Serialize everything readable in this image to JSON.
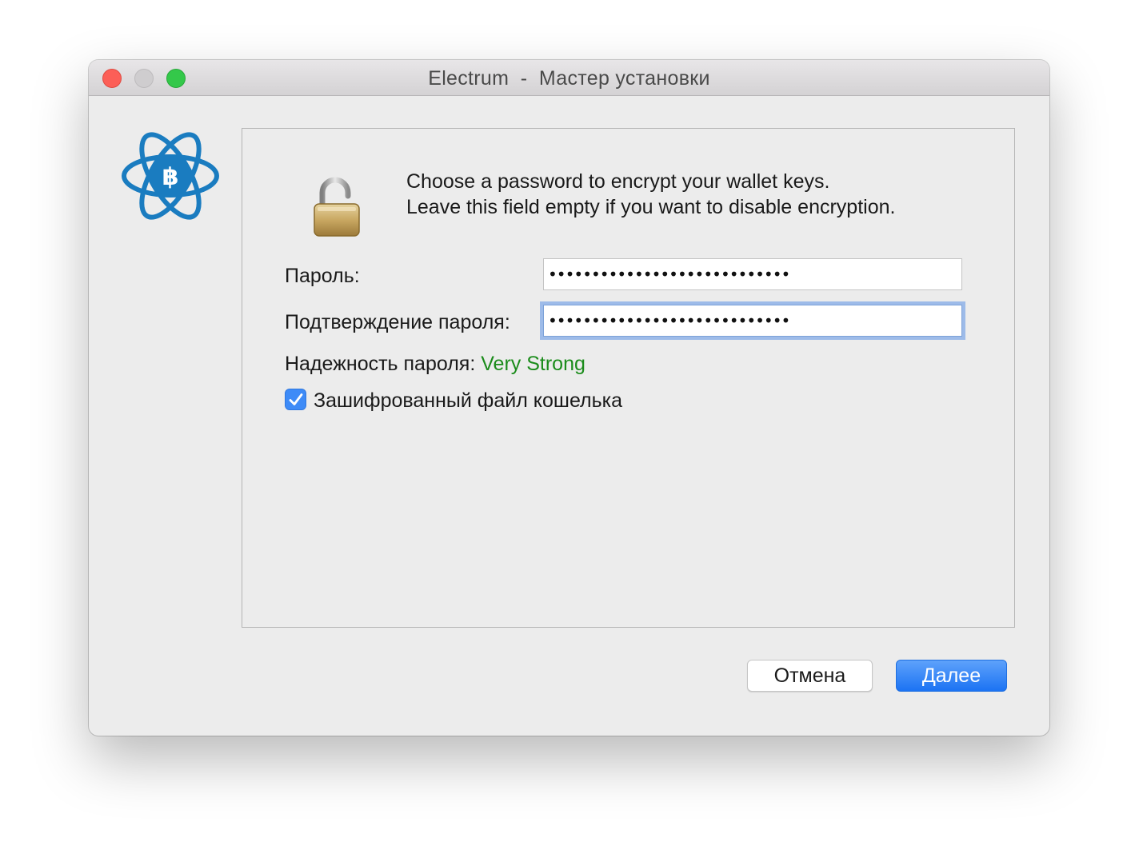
{
  "window": {
    "title": "Electrum  -  Мастер установки"
  },
  "icons": {
    "app_logo": "electrum-atom-bitcoin-icon",
    "lock": "open-padlock-icon"
  },
  "message": {
    "line1": "Choose a password to encrypt your wallet keys.",
    "line2": "Leave this field empty if you want to disable encryption."
  },
  "form": {
    "password_label": "Пароль:",
    "password_value": "••••••••••••••••••••••••••••",
    "confirm_label": "Подтверждение пароля:",
    "confirm_value": "••••••••••••••••••••••••••••",
    "strength_label": "Надежность пароля:",
    "strength_value": "Very Strong",
    "encrypt_checkbox_label": "Зашифрованный файл кошелька",
    "encrypt_checked": true
  },
  "buttons": {
    "cancel": "Отмена",
    "next": "Далее"
  },
  "colors": {
    "strength": "#1b8c1b",
    "accent": "#1c73f3",
    "logo": "#1a7cc0"
  }
}
